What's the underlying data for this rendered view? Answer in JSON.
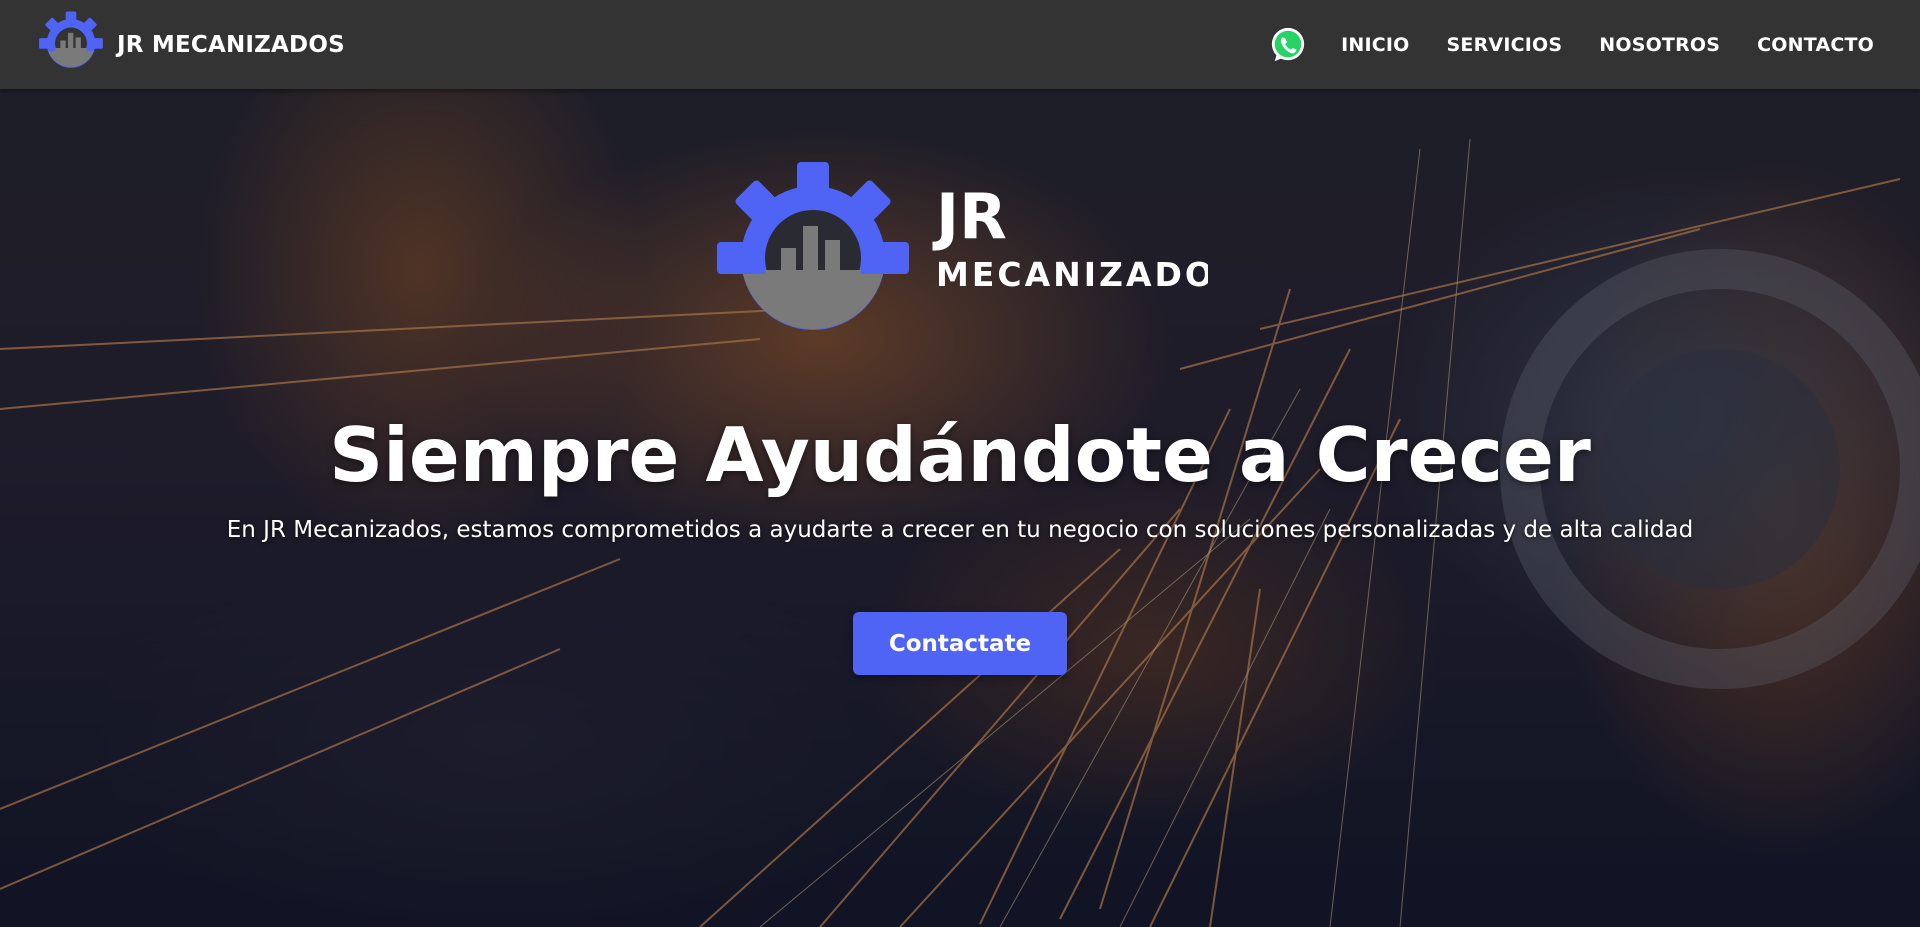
{
  "brand": {
    "name": "JR MECANIZADOS",
    "logo_icon": "gear-chart-icon"
  },
  "nav": {
    "whatsapp_icon": "whatsapp-icon",
    "items": [
      {
        "label": "INICIO"
      },
      {
        "label": "SERVICIOS"
      },
      {
        "label": "NOSOTROS"
      },
      {
        "label": "CONTACTO"
      }
    ]
  },
  "hero": {
    "logo_line1": "JR",
    "logo_line2": "MECANIZADOS",
    "title": "Siempre Ayudándote a Crecer",
    "subtitle": "En JR Mecanizados, estamos comprometidos a ayudarte a crecer en tu negocio con soluciones personalizadas y de alta calidad",
    "cta_label": "Contactate"
  },
  "colors": {
    "navbar": "#333333",
    "accent_blue": "#4f63f5",
    "logo_gray": "#7a7a7a",
    "whatsapp_green": "#25d366"
  }
}
